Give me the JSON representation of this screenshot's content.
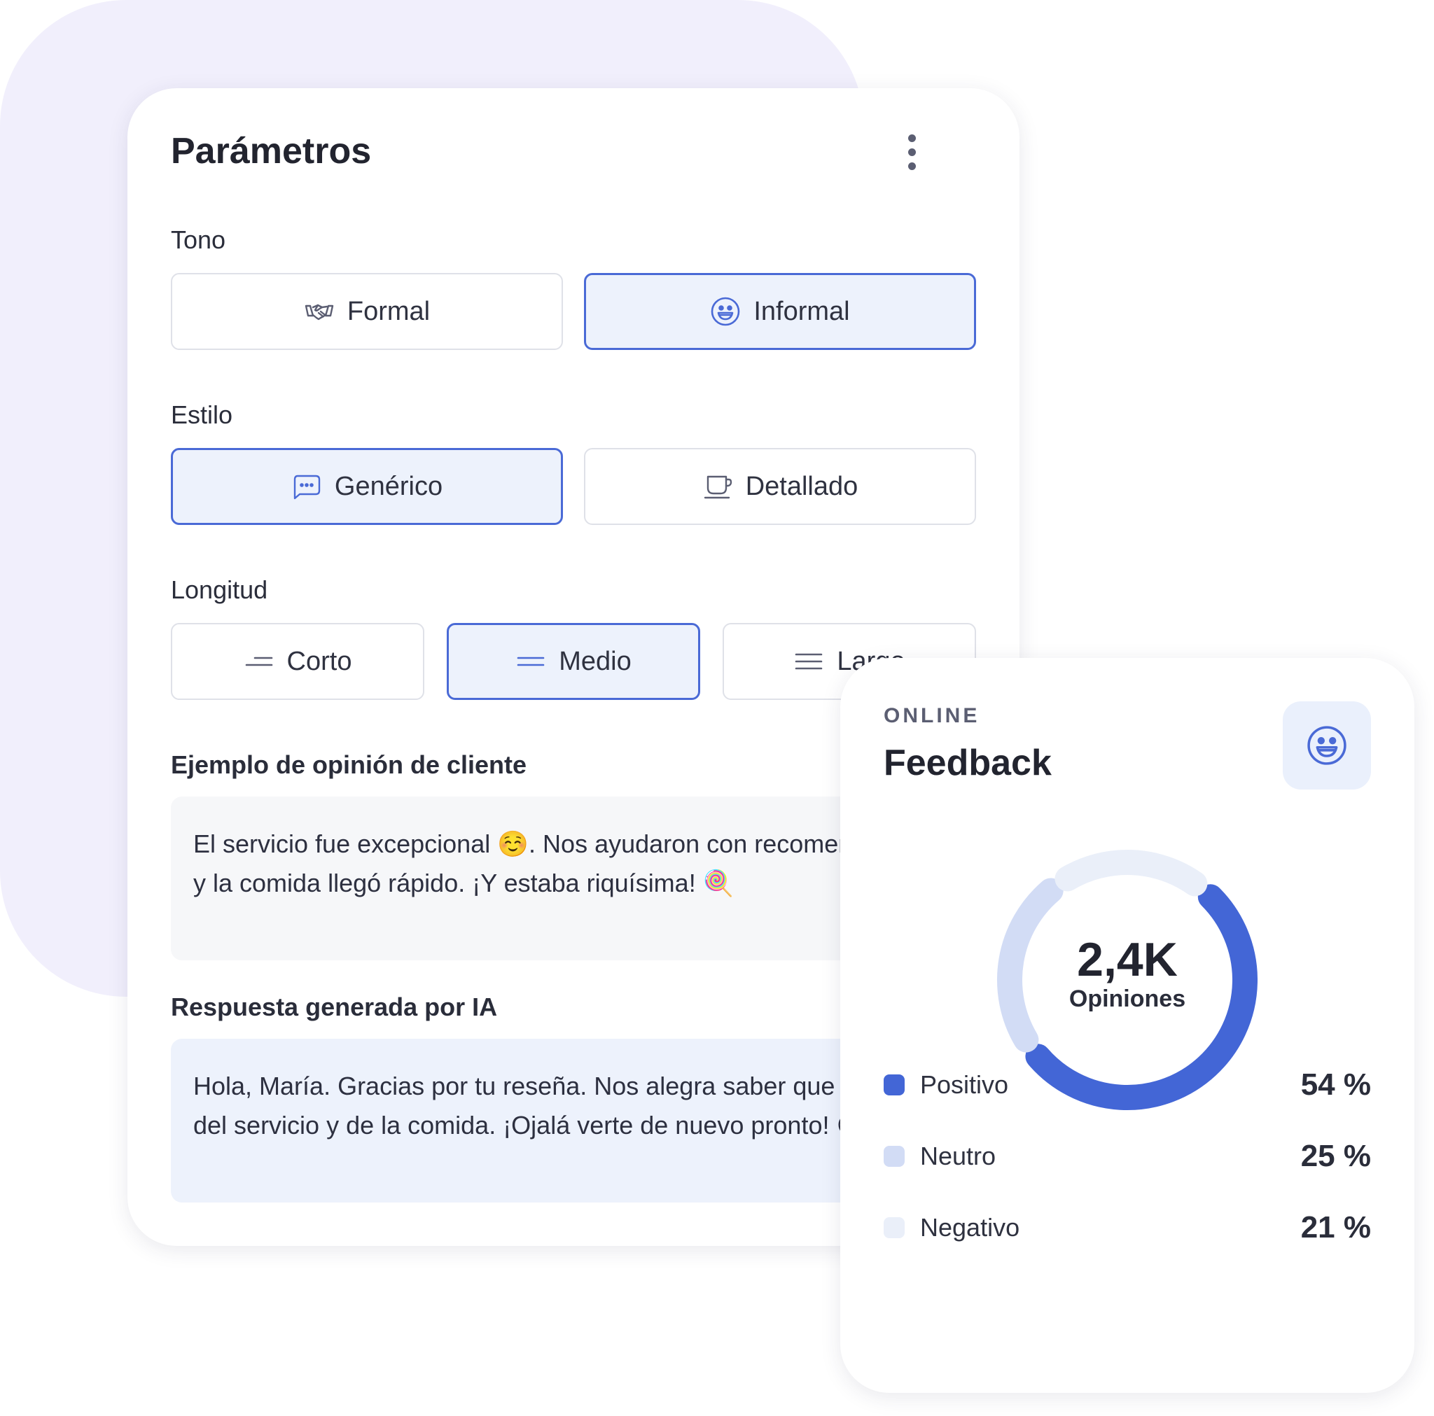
{
  "params": {
    "title": "Parámetros",
    "tono": {
      "label": "Tono",
      "options": [
        {
          "label": "Formal",
          "icon": "handshake-icon",
          "selected": false
        },
        {
          "label": "Informal",
          "icon": "smile-icon",
          "selected": true
        }
      ]
    },
    "estilo": {
      "label": "Estilo",
      "options": [
        {
          "label": "Genérico",
          "icon": "chat-bubble-icon",
          "selected": true
        },
        {
          "label": "Detallado",
          "icon": "cup-icon",
          "selected": false
        }
      ]
    },
    "longitud": {
      "label": "Longitud",
      "options": [
        {
          "label": "Corto",
          "icon": "short-lines-icon",
          "selected": false
        },
        {
          "label": "Medio",
          "icon": "medium-lines-icon",
          "selected": true
        },
        {
          "label": "Largo",
          "icon": "long-lines-icon",
          "selected": false
        }
      ]
    },
    "example": {
      "label": "Ejemplo de opinión de cliente",
      "text": "El servicio fue excepcional ☺️. Nos ayudaron con recomendaciones y la comida llegó rápido. ¡Y estaba riquísima! 🍭"
    },
    "response": {
      "label": "Respuesta generada por IA",
      "text": "Hola, María. Gracias por tu reseña. Nos alegra saber que disfrutaste del servicio y de la comida. ¡Ojalá verte de nuevo pronto! 😊"
    }
  },
  "feedback": {
    "eyebrow": "ONLINE",
    "title": "Feedback",
    "icon": "smile-icon",
    "total": "2,4K",
    "total_label": "Opiniones",
    "legend": [
      {
        "name": "Positivo",
        "value": "54 %",
        "color": "#4366d6"
      },
      {
        "name": "Neutro",
        "value": "25 %",
        "color": "#d2dcf5"
      },
      {
        "name": "Negativo",
        "value": "21 %",
        "color": "#eaeff9"
      }
    ]
  },
  "chart_data": {
    "type": "pie",
    "categories": [
      "Positivo",
      "Neutro",
      "Negativo"
    ],
    "values": [
      54,
      25,
      21
    ],
    "colors": [
      "#4366d6",
      "#d2dcf5",
      "#eaeff9"
    ],
    "title": "Feedback",
    "center_value": "2,4K",
    "center_label": "Opiniones"
  }
}
